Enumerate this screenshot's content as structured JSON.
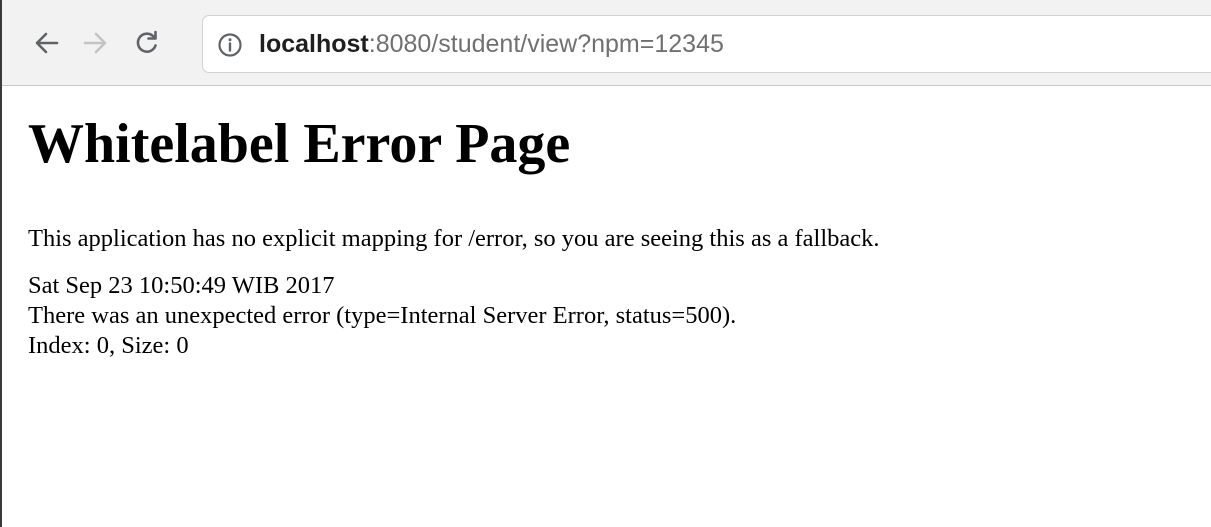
{
  "browser": {
    "address_bar": {
      "host": "localhost",
      "path": ":8080/student/view?npm=12345"
    },
    "icons": {
      "back": "back-arrow-icon",
      "forward": "forward-arrow-icon",
      "reload": "reload-icon",
      "info": "info-icon"
    }
  },
  "page": {
    "title": "Whitelabel Error Page",
    "message": "This application has no explicit mapping for /error, so you are seeing this as a fallback.",
    "timestamp": "Sat Sep 23 10:50:49 WIB 2017",
    "error_line": "There was an unexpected error (type=Internal Server Error, status=500).",
    "error_detail": "Index: 0, Size: 0"
  }
}
